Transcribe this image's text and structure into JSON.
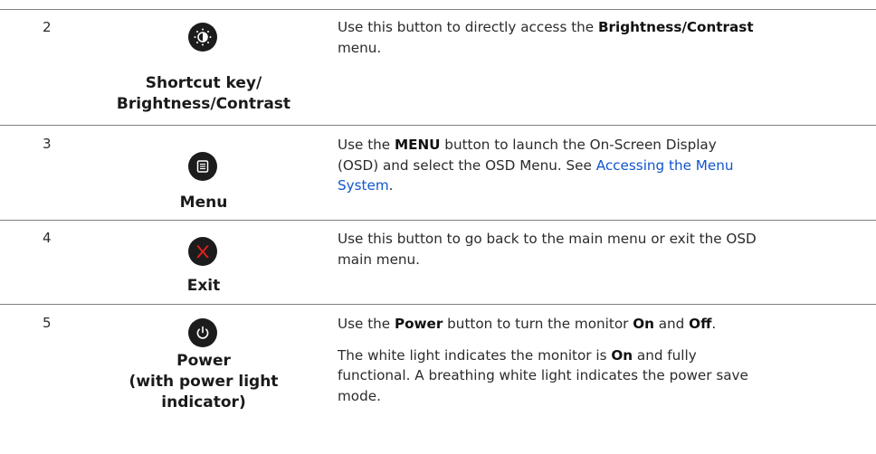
{
  "rows": [
    {
      "number": "2",
      "icon": "brightness-contrast-icon",
      "label_lines": [
        "Shortcut key/",
        "Brightness/Contrast"
      ],
      "description": {
        "pre": "Use this button to directly access the ",
        "bold": "Brightness/Contrast",
        "post": "",
        "line2": "menu."
      }
    },
    {
      "number": "3",
      "icon": "menu-icon",
      "label_lines": [
        "Menu"
      ],
      "description": {
        "pre": "Use the ",
        "bold": "MENU",
        "post": " button to launch the On-Screen Display",
        "line2_pre": "(OSD) and select the OSD Menu. See ",
        "link_part1": "Accessing the Menu",
        "link_part2": "System",
        "line3_post": "."
      }
    },
    {
      "number": "4",
      "icon": "exit-icon",
      "label_lines": [
        "Exit"
      ],
      "description": {
        "line1": "Use this button to go back to the main menu or exit the OSD",
        "line2": "main menu."
      }
    },
    {
      "number": "5",
      "icon": "power-icon",
      "label_lines": [
        "Power",
        "(with power light",
        "indicator)"
      ],
      "description": {
        "p1_pre": "Use the ",
        "p1_bold1": "Power",
        "p1_mid": " button to turn the monitor ",
        "p1_bold2": "On",
        "p1_and": " and ",
        "p1_bold3": "Off",
        "p1_end": ".",
        "p2_pre": "The white light indicates the monitor is ",
        "p2_bold": "On",
        "p2_post": " and fully",
        "p2_line2": "functional. A breathing white light indicates the power save",
        "p2_line3": "mode."
      }
    }
  ],
  "colors": {
    "icon_bg": "#1c1c1c",
    "exit_x": "#e02020",
    "link": "#1155cc",
    "divider": "#7f7f7f"
  }
}
